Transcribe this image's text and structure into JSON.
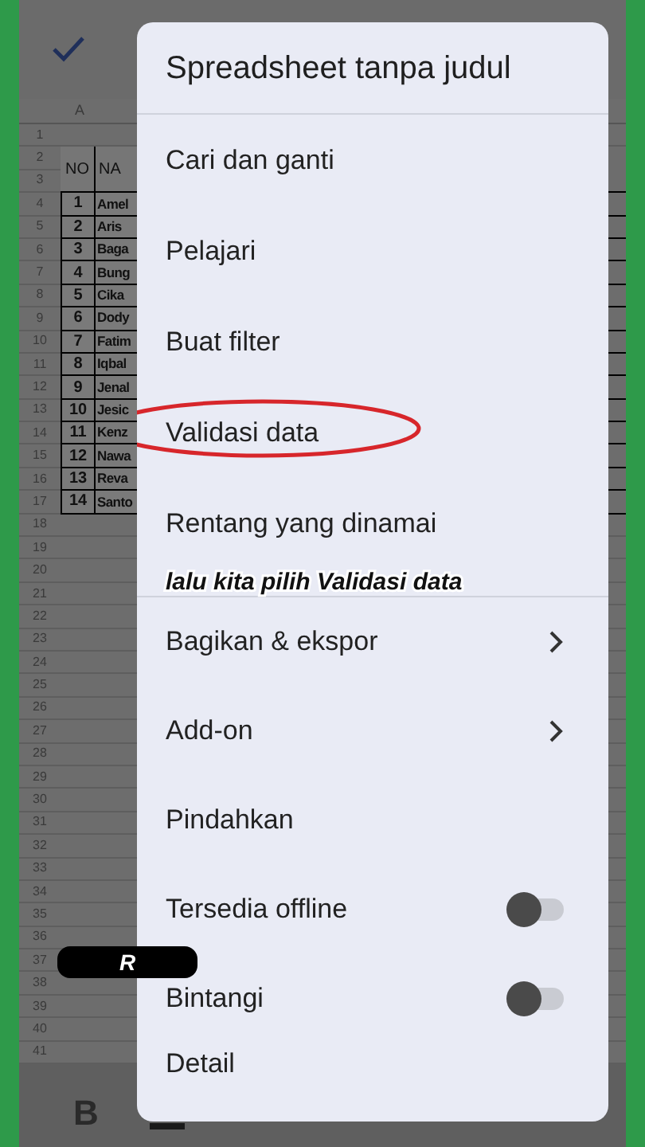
{
  "sheet": {
    "column_header": "A",
    "header": {
      "no": "NO",
      "name": "NA"
    },
    "rows": [
      {
        "no": "1",
        "name": "Amel"
      },
      {
        "no": "2",
        "name": "Aris"
      },
      {
        "no": "3",
        "name": "Baga"
      },
      {
        "no": "4",
        "name": "Bung"
      },
      {
        "no": "5",
        "name": "Cika"
      },
      {
        "no": "6",
        "name": "Dody"
      },
      {
        "no": "7",
        "name": "Fatim"
      },
      {
        "no": "8",
        "name": "Iqbal"
      },
      {
        "no": "9",
        "name": "Jenal"
      },
      {
        "no": "10",
        "name": "Jesic"
      },
      {
        "no": "11",
        "name": "Kenz"
      },
      {
        "no": "12",
        "name": "Nawa"
      },
      {
        "no": "13",
        "name": "Reva"
      },
      {
        "no": "14",
        "name": "Santo"
      }
    ],
    "row_numbers": [
      "1",
      "2",
      "3",
      "4",
      "5",
      "6",
      "7",
      "8",
      "9",
      "10",
      "11",
      "12",
      "13",
      "14",
      "15",
      "16",
      "17",
      "18",
      "19",
      "20",
      "21",
      "22",
      "23",
      "24",
      "25",
      "26",
      "27",
      "28",
      "29",
      "30",
      "31",
      "32",
      "33",
      "34",
      "35",
      "36",
      "37",
      "38",
      "39",
      "40",
      "41"
    ]
  },
  "toolbar": {
    "bold": "B"
  },
  "menu": {
    "title": "Spreadsheet tanpa judul",
    "groups": [
      [
        {
          "label": "Cari dan ganti",
          "kind": "plain",
          "circled": false
        },
        {
          "label": "Pelajari",
          "kind": "plain",
          "circled": false
        },
        {
          "label": "Buat filter",
          "kind": "plain",
          "circled": false
        },
        {
          "label": "Validasi data",
          "kind": "plain",
          "circled": true
        },
        {
          "label": "Rentang yang dinamai",
          "kind": "plain",
          "circled": false
        }
      ],
      [
        {
          "label": "Bagikan & ekspor",
          "kind": "submenu",
          "circled": false
        },
        {
          "label": "Add-on",
          "kind": "submenu",
          "circled": false
        },
        {
          "label": "Pindahkan",
          "kind": "plain",
          "circled": false
        },
        {
          "label": "Tersedia offline",
          "kind": "toggle",
          "on": false,
          "circled": false
        },
        {
          "label": "Bintangi",
          "kind": "toggle",
          "on": false,
          "circled": false
        },
        {
          "label": "Detail",
          "kind": "plain",
          "circled": false
        }
      ]
    ]
  },
  "caption": "lalu kita pilih Validasi data",
  "redaction": {
    "text": "R"
  }
}
